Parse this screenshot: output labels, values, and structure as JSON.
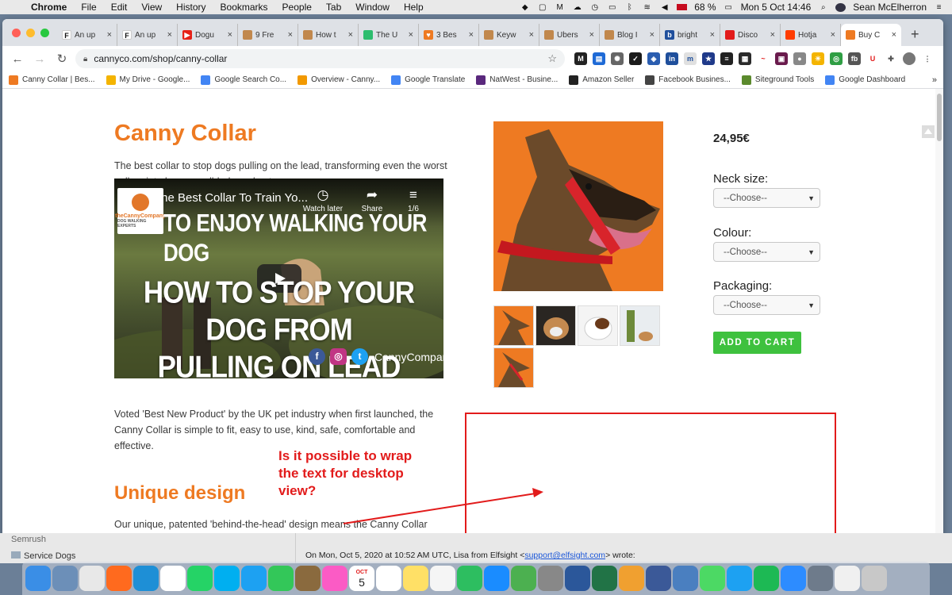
{
  "menubar": {
    "app": "Chrome",
    "items": [
      "File",
      "Edit",
      "View",
      "History",
      "Bookmarks",
      "People",
      "Tab",
      "Window",
      "Help"
    ],
    "battery": "68 %",
    "datetime": "Mon 5 Oct  14:46",
    "user": "Sean McElherron"
  },
  "tabs": [
    {
      "title": "An up",
      "color": "#ffffff",
      "glyph": "F"
    },
    {
      "title": "An up",
      "color": "#ffffff",
      "glyph": "F"
    },
    {
      "title": "Dogu",
      "color": "#e62117",
      "glyph": "▶"
    },
    {
      "title": "9 Fre",
      "color": "#c1884d",
      "glyph": ""
    },
    {
      "title": "How t",
      "color": "#c1884d",
      "glyph": ""
    },
    {
      "title": "The U",
      "color": "#2dbd6e",
      "glyph": ""
    },
    {
      "title": "3 Bes",
      "color": "#ee7a22",
      "glyph": "♥"
    },
    {
      "title": "Keyw",
      "color": "#c1884d",
      "glyph": ""
    },
    {
      "title": "Ubers",
      "color": "#c1884d",
      "glyph": ""
    },
    {
      "title": "Blog I",
      "color": "#c1884d",
      "glyph": ""
    },
    {
      "title": "bright",
      "color": "#1f4f9c",
      "glyph": "b"
    },
    {
      "title": "Disco",
      "color": "#e21b1b",
      "glyph": ""
    },
    {
      "title": "Hotja",
      "color": "#ff3c00",
      "glyph": ""
    },
    {
      "title": "Buy C",
      "color": "#ee7a22",
      "glyph": ""
    }
  ],
  "address": {
    "url": "cannyco.com/shop/canny-collar"
  },
  "bookmarks": [
    {
      "label": "Canny Collar | Bes...",
      "color": "#ee7a22"
    },
    {
      "label": "My Drive - Google...",
      "color": "#f4b400"
    },
    {
      "label": "Google Search Co...",
      "color": "#4285f4"
    },
    {
      "label": "Overview - Canny...",
      "color": "#f29900"
    },
    {
      "label": "Google Translate",
      "color": "#4285f4"
    },
    {
      "label": "NatWest - Busine...",
      "color": "#5a287d"
    },
    {
      "label": "Amazon Seller",
      "color": "#222222"
    },
    {
      "label": "Facebook Busines...",
      "color": "#444444"
    },
    {
      "label": "Siteground Tools",
      "color": "#5b8a2d"
    },
    {
      "label": "Google Dashboard",
      "color": "#4285f4"
    }
  ],
  "bookmarks_more": "»",
  "product": {
    "title": "Canny Collar",
    "intro": "The best collar to stop dogs pulling on the lead, transforming even the worst pullers into happy, well-behaved pets.",
    "para2": "Voted 'Best New Product' by the UK pet industry when first launched, the Canny Collar is simple to fit, easy to use, kind, safe, comfortable and effective.",
    "subheading": "Unique design",
    "para3": "Our unique, patented 'behind-the-head' design means the Canny Collar does not ride up into your dog's eyes nor yank her head to one side, both of which will cause her distress, discomfort and which could damage her neck.",
    "price": "24,95€",
    "neck_label": "Neck size:",
    "colour_label": "Colour:",
    "packaging_label": "Packaging:",
    "select_default": "--Choose--",
    "cart_label": "ADD TO CART"
  },
  "video": {
    "title": "The Best Collar To Train Yo...",
    "watch_later": "Watch later",
    "share": "Share",
    "counter": "1/6",
    "logo_line1": "theCannyCompany",
    "logo_line2": "DOG WALKING EXPERTS",
    "top_text": "TO ENJOY WALKING YOUR DOG",
    "main_line1": "HOW TO STOP YOUR DOG FROM",
    "main_line2": "PULLING ON LEAD",
    "handle": "CannyCompany"
  },
  "annotation": {
    "text": "Is it possible to wrap the text for desktop view?"
  },
  "behind": {
    "sidebar_item1": "Semrush",
    "sidebar_item2": "Service Dogs",
    "mail_prefix": "On Mon, Oct 5, 2020 at 10:52 AM UTC, Lisa from Elfsight <",
    "mail_link": "support@elfsight.com",
    "mail_suffix": "> wrote:"
  },
  "dock_apps": [
    {
      "name": "finder",
      "color": "#3a8ee6"
    },
    {
      "name": "preview",
      "color": "#6c8fb8"
    },
    {
      "name": "chrome",
      "color": "#e8e8e8"
    },
    {
      "name": "firefox",
      "color": "#ff6a1e"
    },
    {
      "name": "edge",
      "color": "#1e8fd6"
    },
    {
      "name": "slack",
      "color": "#ffffff"
    },
    {
      "name": "whatsapp",
      "color": "#25d366"
    },
    {
      "name": "skype",
      "color": "#00aff0"
    },
    {
      "name": "tweetdeck",
      "color": "#1da1f2"
    },
    {
      "name": "facetime",
      "color": "#33c759"
    },
    {
      "name": "notes-brown",
      "color": "#8a6a3e"
    },
    {
      "name": "itunes",
      "color": "#fb5bc5"
    },
    {
      "name": "calendar",
      "color": "#ffffff"
    },
    {
      "name": "reminders",
      "color": "#ffffff"
    },
    {
      "name": "notes",
      "color": "#ffe066"
    },
    {
      "name": "textedit",
      "color": "#f5f5f5"
    },
    {
      "name": "evernote",
      "color": "#2dbe60"
    },
    {
      "name": "appstore",
      "color": "#1a8cff"
    },
    {
      "name": "ladybug",
      "color": "#4cb050"
    },
    {
      "name": "scanner",
      "color": "#888888"
    },
    {
      "name": "word",
      "color": "#2b579a"
    },
    {
      "name": "excel",
      "color": "#217346"
    },
    {
      "name": "photos",
      "color": "#f0a030"
    },
    {
      "name": "monitor",
      "color": "#3b5998"
    },
    {
      "name": "photo-viewer",
      "color": "#4a7fc0"
    },
    {
      "name": "messages",
      "color": "#4cd964"
    },
    {
      "name": "twitter",
      "color": "#1da1f2"
    },
    {
      "name": "spotify",
      "color": "#1db954"
    },
    {
      "name": "zoom",
      "color": "#2d8cff"
    },
    {
      "name": "launchpad",
      "color": "#6e7b8b"
    },
    {
      "name": "screenshot",
      "color": "#f0f0f0"
    },
    {
      "name": "trash",
      "color": "#c8c8c8"
    }
  ],
  "dock_calendar": {
    "month": "OCT",
    "day": "5"
  }
}
